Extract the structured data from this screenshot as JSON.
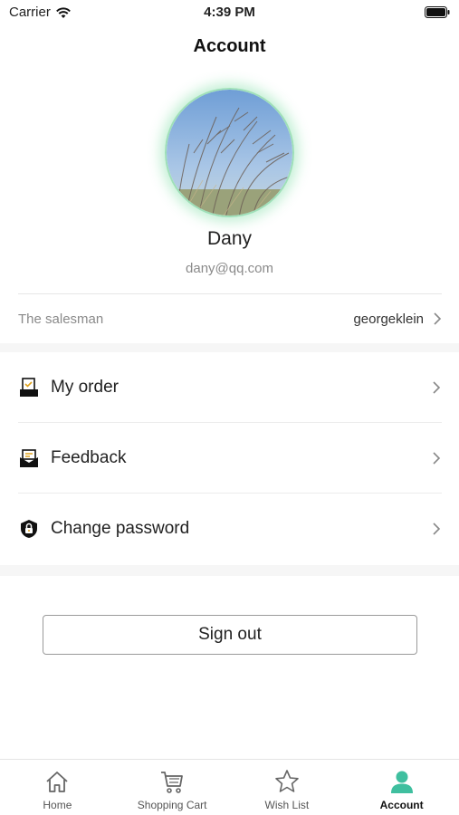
{
  "status_bar": {
    "carrier": "Carrier",
    "time": "4:39 PM"
  },
  "header": {
    "title": "Account"
  },
  "profile": {
    "name": "Dany",
    "email": "dany@qq.com"
  },
  "salesman": {
    "label": "The salesman",
    "value": "georgeklein"
  },
  "menu": {
    "items": [
      {
        "label": "My order",
        "icon": "order-icon"
      },
      {
        "label": "Feedback",
        "icon": "feedback-icon"
      },
      {
        "label": "Change password",
        "icon": "lock-icon"
      }
    ]
  },
  "sign_out_label": "Sign out",
  "tabs": [
    {
      "label": "Home",
      "icon": "home-icon"
    },
    {
      "label": "Shopping Cart",
      "icon": "cart-icon"
    },
    {
      "label": "Wish List",
      "icon": "star-icon"
    },
    {
      "label": "Account",
      "icon": "person-icon",
      "active": true
    }
  ],
  "colors": {
    "accent": "#3fbf9f",
    "tab_inactive": "#666666"
  }
}
